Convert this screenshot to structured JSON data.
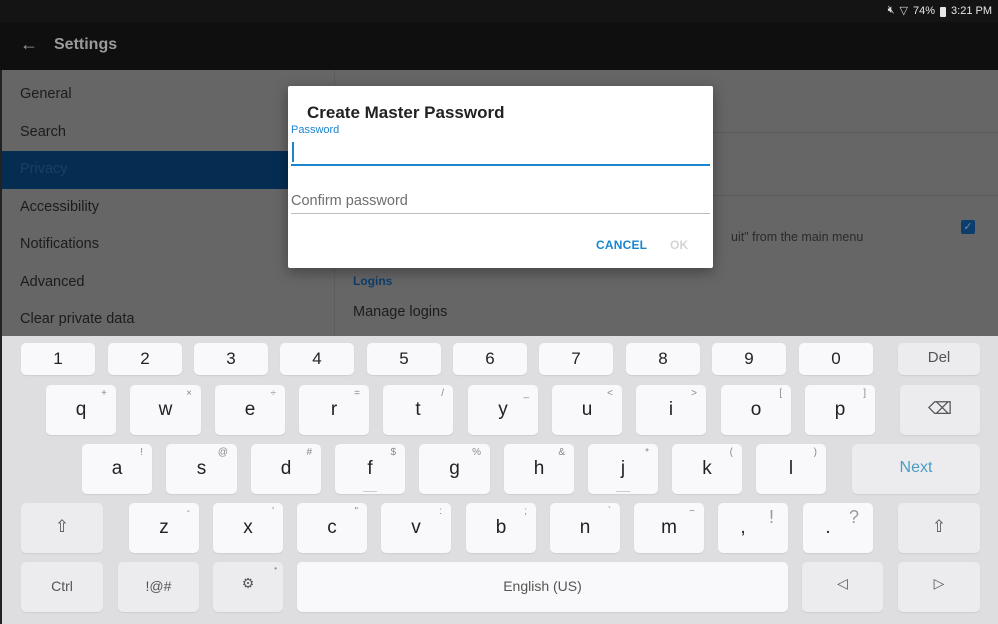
{
  "status_bar": {
    "mute_icon": "mute-icon",
    "wifi_icon": "wifi-icon",
    "battery_percent": "74%",
    "battery_icon": "battery-icon",
    "time": "3:21 PM"
  },
  "app_bar": {
    "back_icon": "back-arrow-icon",
    "title": "Settings"
  },
  "settings": {
    "nav_items": [
      {
        "label": "General",
        "selected": false
      },
      {
        "label": "Search",
        "selected": false
      },
      {
        "label": "Privacy",
        "selected": true
      },
      {
        "label": "Accessibility",
        "selected": false
      },
      {
        "label": "Notifications",
        "selected": false
      },
      {
        "label": "Advanced",
        "selected": false
      },
      {
        "label": "Clear private data",
        "selected": false
      }
    ],
    "content": {
      "quit_text_fragment": "uit\" from the main menu",
      "quit_checkbox_checked": true,
      "section_header": "Logins",
      "manage_logins": "Manage logins"
    }
  },
  "dialog": {
    "title": "Create Master Password",
    "password_label": "Password",
    "password_value": "",
    "confirm_placeholder": "Confirm password",
    "confirm_value": "",
    "cancel_label": "CANCEL",
    "ok_label": "OK",
    "ok_enabled": false
  },
  "keyboard": {
    "number_row": [
      "1",
      "2",
      "3",
      "4",
      "5",
      "6",
      "7",
      "8",
      "9",
      "0"
    ],
    "del_label": "Del",
    "row1": [
      {
        "key": "q",
        "alt": "+"
      },
      {
        "key": "w",
        "alt": "×"
      },
      {
        "key": "e",
        "alt": "÷"
      },
      {
        "key": "r",
        "alt": "="
      },
      {
        "key": "t",
        "alt": "/"
      },
      {
        "key": "y",
        "alt": "_"
      },
      {
        "key": "u",
        "alt": "<"
      },
      {
        "key": "i",
        "alt": ">"
      },
      {
        "key": "o",
        "alt": "["
      },
      {
        "key": "p",
        "alt": "]"
      }
    ],
    "backspace_icon": "backspace-icon",
    "row2": [
      {
        "key": "a",
        "alt": "!"
      },
      {
        "key": "s",
        "alt": "@"
      },
      {
        "key": "d",
        "alt": "#"
      },
      {
        "key": "f",
        "alt": "$"
      },
      {
        "key": "g",
        "alt": "%"
      },
      {
        "key": "h",
        "alt": "&"
      },
      {
        "key": "j",
        "alt": "*"
      },
      {
        "key": "k",
        "alt": "("
      },
      {
        "key": "l",
        "alt": ")"
      }
    ],
    "next_label": "Next",
    "shift_icon": "shift-icon",
    "row3": [
      {
        "key": "z",
        "alt": "-"
      },
      {
        "key": "x",
        "alt": "'"
      },
      {
        "key": "c",
        "alt": "\""
      },
      {
        "key": "v",
        "alt": ":"
      },
      {
        "key": "b",
        "alt": ";"
      },
      {
        "key": "n",
        "alt": "`"
      },
      {
        "key": "m",
        "alt": "~"
      },
      {
        "key": ",",
        "alt": "!"
      },
      {
        "key": ".",
        "alt": "?"
      }
    ],
    "ctrl_label": "Ctrl",
    "symbols_label": "!@#",
    "settings_icon": "gear-icon",
    "space_label": "English (US)",
    "left_arrow_icon": "cursor-left-icon",
    "right_arrow_icon": "cursor-right-icon"
  }
}
